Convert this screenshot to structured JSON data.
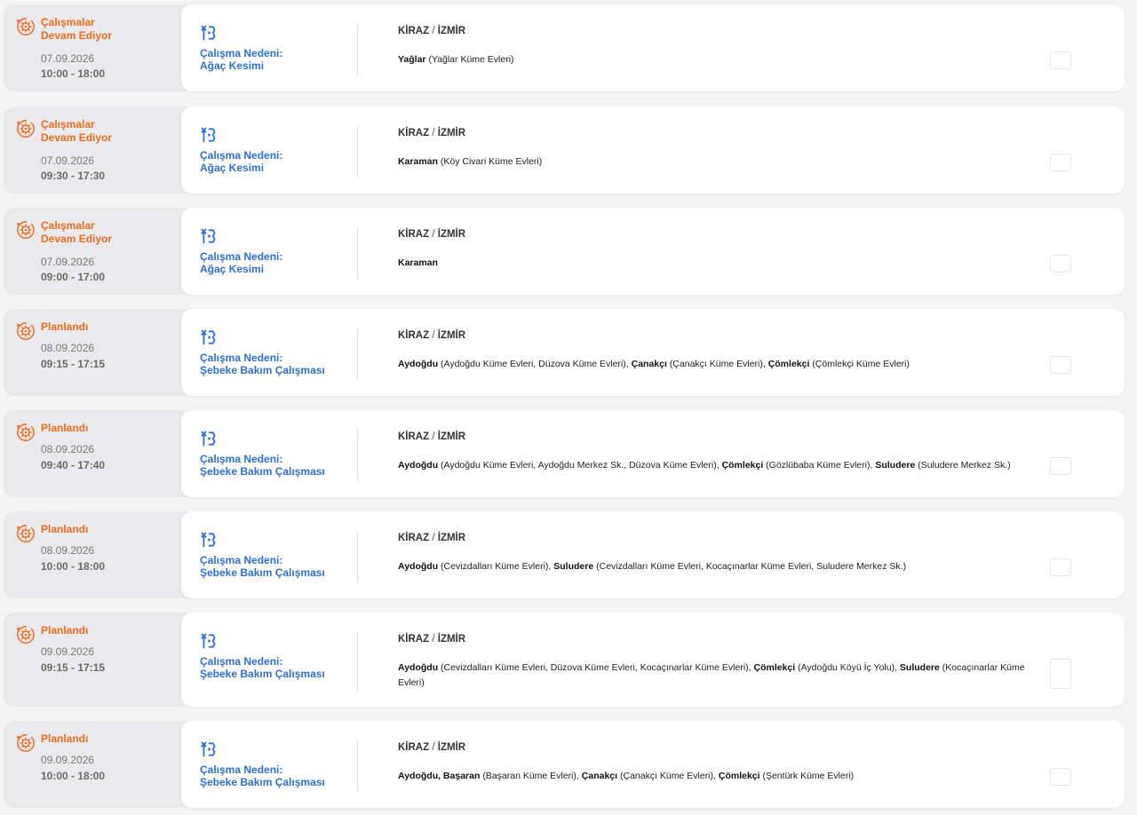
{
  "district": {
    "name": "KİRAZ",
    "separator": "/",
    "city": "İZMİR"
  },
  "reason_label": "Çalışma Nedeni:",
  "colors": {
    "status": "#ef6c1e",
    "reason": "#2f6fd8"
  },
  "rows": [
    {
      "status_line1": "Çalışmalar",
      "status_line2": "Devam Ediyor",
      "date": "07.09.2026",
      "time": "10:00 - 18:00",
      "reason": "Ağaç Kesimi",
      "areas": [
        {
          "name": "Yağlar",
          "detail": "(Yağlar Küme Evleri)"
        }
      ]
    },
    {
      "status_line1": "Çalışmalar",
      "status_line2": "Devam Ediyor",
      "date": "07.09.2026",
      "time": "09:30 - 17:30",
      "reason": "Ağaç Kesimi",
      "areas": [
        {
          "name": "Karaman",
          "detail": "(Köy Civari Küme Evleri)"
        }
      ]
    },
    {
      "status_line1": "Çalışmalar",
      "status_line2": "Devam Ediyor",
      "date": "07.09.2026",
      "time": "09:00 - 17:00",
      "reason": "Ağaç Kesimi",
      "areas": [
        {
          "name": "Karaman",
          "detail": ""
        }
      ]
    },
    {
      "status_line1": "Planlandı",
      "status_line2": "",
      "date": "08.09.2026",
      "time": "09:15 - 17:15",
      "reason": "Şebeke Bakım Çalışması",
      "areas": [
        {
          "name": "Aydoğdu",
          "detail": "(Aydoğdu Küme Evleri, Düzova Küme Evleri)"
        },
        {
          "name": "Çanakçı",
          "detail": "(Çanakçı Küme Evleri)"
        },
        {
          "name": "Çömlekçi",
          "detail": "(Çömlekçi Küme Evleri)"
        }
      ]
    },
    {
      "status_line1": "Planlandı",
      "status_line2": "",
      "date": "08.09.2026",
      "time": "09:40 - 17:40",
      "reason": "Şebeke Bakım Çalışması",
      "areas": [
        {
          "name": "Aydoğdu",
          "detail": "(Aydoğdu Küme Evleri, Aydoğdu Merkez Sk., Düzova Küme Evleri)"
        },
        {
          "name": "Çömlekçi",
          "detail": "(Gözlübaba Küme Evleri)"
        },
        {
          "name": "Suludere",
          "detail": "(Suludere Merkez Sk.)"
        }
      ]
    },
    {
      "status_line1": "Planlandı",
      "status_line2": "",
      "date": "08.09.2026",
      "time": "10:00 - 18:00",
      "reason": "Şebeke Bakım Çalışması",
      "areas": [
        {
          "name": "Aydoğdu",
          "detail": "(Cevizdalları Küme Evleri)"
        },
        {
          "name": "Suludere",
          "detail": "(Cevizdalları Küme Evleri, Kocaçınarlar Küme Evleri, Suludere Merkez Sk.)"
        }
      ]
    },
    {
      "status_line1": "Planlandı",
      "status_line2": "",
      "date": "09.09.2026",
      "time": "09:15 - 17:15",
      "reason": "Şebeke Bakım Çalışması",
      "areas": [
        {
          "name": "Aydoğdu",
          "detail": "(Cevizdalları Küme Evleri, Düzova Küme Evleri, Kocaçınarlar Küme Evleri)"
        },
        {
          "name": "Çömlekçi",
          "detail": "(Aydoğdu Köyü İç Yolu)"
        },
        {
          "name": "Suludere",
          "detail": "(Kocaçınarlar Küme Evleri)"
        }
      ]
    },
    {
      "status_line1": "Planlandı",
      "status_line2": "",
      "date": "09.09.2026",
      "time": "10:00 - 18:00",
      "reason": "Şebeke Bakım Çalışması",
      "areas": [
        {
          "name": "Aydoğdu, Başaran",
          "detail": "(Başaran Küme Evleri)"
        },
        {
          "name": "Çanakçı",
          "detail": "(Çanakçı Küme Evleri)"
        },
        {
          "name": "Çömlekçi",
          "detail": "(Şentürk Küme Evleri)"
        }
      ]
    }
  ]
}
